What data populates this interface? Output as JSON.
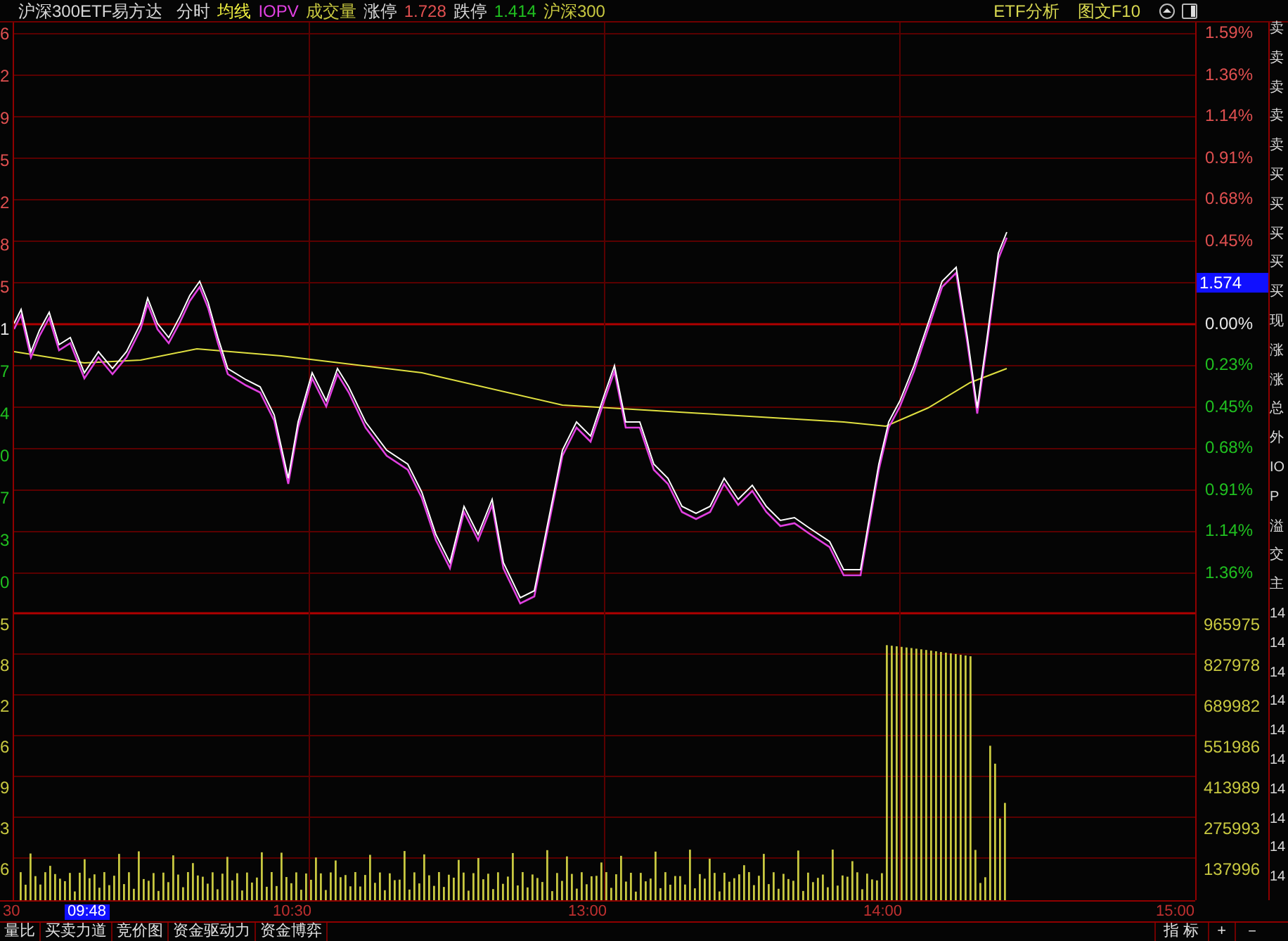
{
  "header": {
    "title": "沪深300ETF易方达",
    "items": [
      {
        "text": "分时",
        "kind": "plain"
      },
      {
        "text": "均线",
        "kind": "avg"
      },
      {
        "text": "IOPV",
        "kind": "iopv"
      },
      {
        "text": "成交量",
        "kind": "vol"
      },
      {
        "text": "涨停",
        "kind": "plain"
      },
      {
        "text": "1.728",
        "kind": "up"
      },
      {
        "text": "跌停",
        "kind": "plain"
      },
      {
        "text": "1.414",
        "kind": "down"
      },
      {
        "text": "沪深300",
        "kind": "vol"
      }
    ],
    "links": [
      "ETF分析",
      "图文F10"
    ]
  },
  "left_axis": [
    {
      "text": "6",
      "kind": "up"
    },
    {
      "text": "2",
      "kind": "up"
    },
    {
      "text": "9",
      "kind": "up"
    },
    {
      "text": "5",
      "kind": "up"
    },
    {
      "text": "2",
      "kind": "up"
    },
    {
      "text": "8",
      "kind": "up"
    },
    {
      "text": "5",
      "kind": "up"
    },
    {
      "text": "1",
      "kind": "flat"
    },
    {
      "text": "7",
      "kind": "down"
    },
    {
      "text": "4",
      "kind": "down"
    },
    {
      "text": "0",
      "kind": "down"
    },
    {
      "text": "7",
      "kind": "down"
    },
    {
      "text": "3",
      "kind": "down"
    },
    {
      "text": "0",
      "kind": "down"
    },
    {
      "text": "5",
      "kind": "vol"
    },
    {
      "text": "8",
      "kind": "vol"
    },
    {
      "text": "2",
      "kind": "vol"
    },
    {
      "text": "6",
      "kind": "vol"
    },
    {
      "text": "9",
      "kind": "vol"
    },
    {
      "text": "3",
      "kind": "vol"
    },
    {
      "text": "6",
      "kind": "vol"
    }
  ],
  "right_axis": [
    {
      "text": "1.59%",
      "kind": "up"
    },
    {
      "text": "1.36%",
      "kind": "up"
    },
    {
      "text": "1.14%",
      "kind": "up"
    },
    {
      "text": "0.91%",
      "kind": "up"
    },
    {
      "text": "0.68%",
      "kind": "up"
    },
    {
      "text": "0.45%",
      "kind": "up"
    },
    {
      "text": "1.574",
      "kind": "current"
    },
    {
      "text": "0.00%",
      "kind": "flat"
    },
    {
      "text": "0.23%",
      "kind": "down"
    },
    {
      "text": "0.45%",
      "kind": "down"
    },
    {
      "text": "0.68%",
      "kind": "down"
    },
    {
      "text": "0.91%",
      "kind": "down"
    },
    {
      "text": "1.14%",
      "kind": "down"
    },
    {
      "text": "1.36%",
      "kind": "down"
    },
    {
      "text": "965975",
      "kind": "vol"
    },
    {
      "text": "827978",
      "kind": "vol"
    },
    {
      "text": "689982",
      "kind": "vol"
    },
    {
      "text": "551986",
      "kind": "vol"
    },
    {
      "text": "413989",
      "kind": "vol"
    },
    {
      "text": "275993",
      "kind": "vol"
    },
    {
      "text": "137996",
      "kind": "vol"
    }
  ],
  "sidebar": [
    "卖",
    "卖",
    "卖",
    "卖",
    "卖",
    "买",
    "买",
    "买",
    "买",
    "买",
    "现",
    "涨",
    "涨",
    "总",
    "外",
    "IO",
    "P",
    "溢",
    "交",
    "主",
    "14",
    "14",
    "14",
    "14",
    "14",
    "14",
    "14",
    "14",
    "14",
    "14"
  ],
  "time_axis": [
    {
      "text": "30",
      "selected": false
    },
    {
      "text": "09:48",
      "selected": true
    },
    {
      "text": "10:30",
      "selected": false
    },
    {
      "text": "13:00",
      "selected": false
    },
    {
      "text": "14:00",
      "selected": false
    },
    {
      "text": "15:00",
      "selected": false
    }
  ],
  "bottom_tabs": [
    "量比",
    "买卖力道",
    "竞价图",
    "资金驱动力",
    "资金博弈"
  ],
  "bottom_controls": [
    "指 标",
    "+",
    "－"
  ]
}
